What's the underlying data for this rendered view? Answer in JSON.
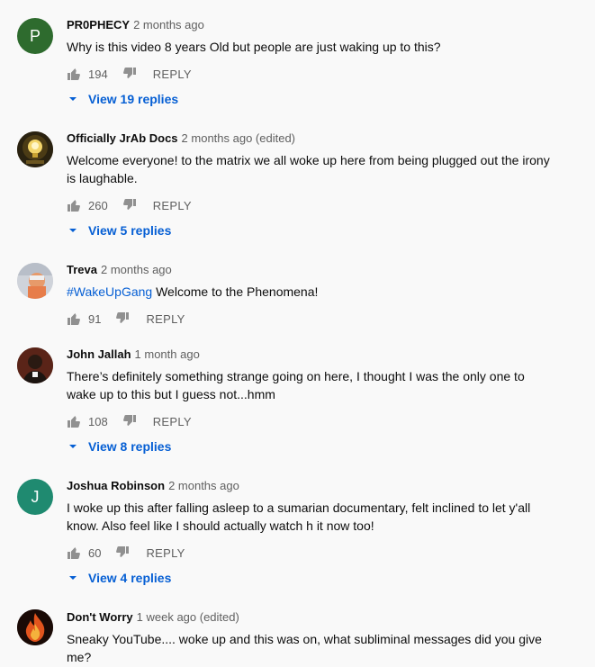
{
  "comments": [
    {
      "author": "PR0PHECY",
      "time": "2 months ago",
      "text": "Why is this video 8 years Old but people are just waking up to this?",
      "likes": "194",
      "reply_label": "REPLY",
      "view_replies": "View 19 replies",
      "avatar_letter": "P",
      "avatar_color": "#2e6b2e"
    },
    {
      "author": "Officially JrAb Docs",
      "time": "2 months ago (edited)",
      "text": "Welcome everyone! to the matrix we all woke up here from being plugged out the irony is laughable.",
      "likes": "260",
      "reply_label": "REPLY",
      "view_replies": "View 5 replies",
      "avatar_icon": "lightbulb-avatar"
    },
    {
      "author": "Treva",
      "time": "2 months ago",
      "hashtag": "#WakeUpGang",
      "text": " Welcome to the Phenomena!",
      "likes": "91",
      "reply_label": "REPLY",
      "avatar_icon": "photo-avatar"
    },
    {
      "author": "John Jallah",
      "time": "1 month ago",
      "text": "There’s definitely something strange going on here, I thought I was the only one to wake up to this but I guess not...hmm",
      "likes": "108",
      "reply_label": "REPLY",
      "view_replies": "View 8 replies",
      "avatar_icon": "person-photo-avatar"
    },
    {
      "author": "Joshua Robinson",
      "time": "2 months ago",
      "text": "I woke up this after falling asleep to a sumarian documentary, felt inclined to let y'all know. Also feel like I should actually watch h it now too!",
      "likes": "60",
      "reply_label": "REPLY",
      "view_replies": "View 4 replies",
      "avatar_letter": "J",
      "avatar_color": "#1f8a70"
    },
    {
      "author": "Don't Worry",
      "time": "1 week ago (edited)",
      "text": "Sneaky YouTube.... woke up and this was on, what subliminal messages did you give me?",
      "avatar_icon": "fire-avatar"
    }
  ],
  "colors": {
    "link_blue": "#065fd4",
    "meta_gray": "#606060",
    "background": "#f9f9f9"
  }
}
